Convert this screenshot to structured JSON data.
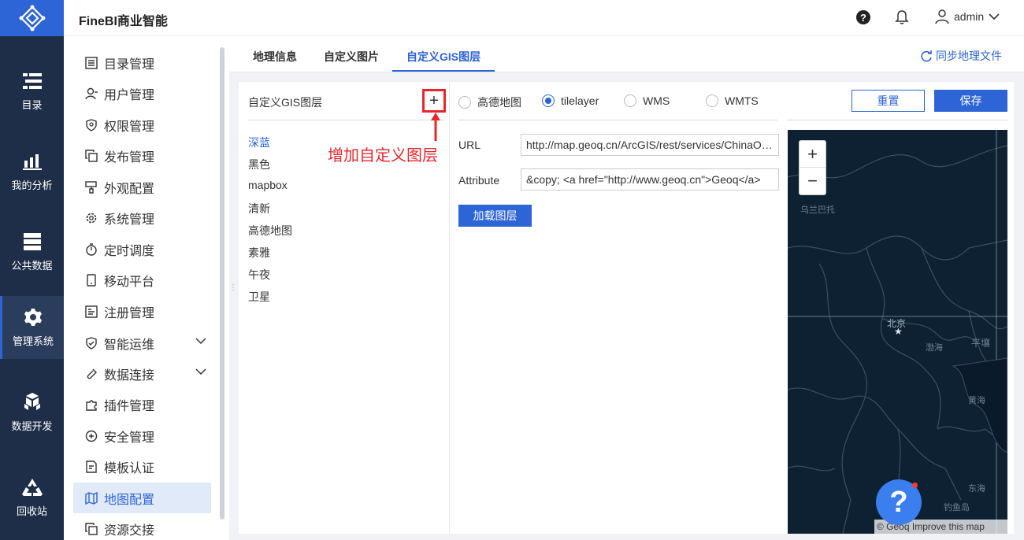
{
  "app": {
    "title": "FineBI商业智能",
    "user": "admin"
  },
  "leftnav": [
    {
      "label": "目录",
      "icon": "catalog-icon"
    },
    {
      "label": "我的分析",
      "icon": "analysis-icon"
    },
    {
      "label": "公共数据",
      "icon": "database-icon"
    },
    {
      "label": "管理系统",
      "icon": "gear-icon",
      "active": true
    },
    {
      "label": "数据开发",
      "icon": "cubes-icon"
    },
    {
      "label": "回收站",
      "icon": "recycle-icon"
    }
  ],
  "submenu": [
    {
      "label": "目录管理",
      "icon": "list-icon"
    },
    {
      "label": "用户管理",
      "icon": "user-icon"
    },
    {
      "label": "权限管理",
      "icon": "shield-icon"
    },
    {
      "label": "发布管理",
      "icon": "copy-icon"
    },
    {
      "label": "外观配置",
      "icon": "brush-icon"
    },
    {
      "label": "系统管理",
      "icon": "gear-icon"
    },
    {
      "label": "定时调度",
      "icon": "timer-icon"
    },
    {
      "label": "移动平台",
      "icon": "phone-icon"
    },
    {
      "label": "注册管理",
      "icon": "register-icon"
    },
    {
      "label": "智能运维",
      "icon": "ops-icon",
      "expandable": true
    },
    {
      "label": "数据连接",
      "icon": "link-icon",
      "expandable": true
    },
    {
      "label": "插件管理",
      "icon": "plugin-icon"
    },
    {
      "label": "安全管理",
      "icon": "security-icon"
    },
    {
      "label": "模板认证",
      "icon": "template-icon"
    },
    {
      "label": "地图配置",
      "icon": "map-icon",
      "active": true
    },
    {
      "label": "资源交接",
      "icon": "resource-icon"
    }
  ],
  "tabs": [
    {
      "label": "地理信息"
    },
    {
      "label": "自定义图片"
    },
    {
      "label": "自定义GIS图层",
      "active": true
    }
  ],
  "sync_label": "同步地理文件",
  "layer_panel": {
    "title": "自定义GIS图层",
    "add_symbol": "+",
    "annotation": "增加自定义图层",
    "layers": [
      "深蓝",
      "黑色",
      "mapbox",
      "清新",
      "高德地图",
      "素雅",
      "午夜",
      "卫星"
    ],
    "selected": "深蓝"
  },
  "config": {
    "types": [
      "高德地图",
      "tilelayer",
      "WMS",
      "WMTS"
    ],
    "selected_type": "tilelayer",
    "url_label": "URL",
    "url_value": "http://map.geoq.cn/ArcGIS/rest/services/ChinaOnlineStreetPurplishBlue/MapServer/tile/{z}/{y}/{x}",
    "attr_label": "Attribute",
    "attr_value": "&copy; <a href=\"http://www.geoq.cn\">Geoq</a>",
    "load_label": "加载图层",
    "reset_label": "重置",
    "save_label": "保存"
  },
  "map": {
    "zoom_in": "+",
    "zoom_out": "−",
    "labels": [
      "乌兰巴托",
      "北京",
      "渤海",
      "平壤",
      "黄海",
      "东海",
      "钓鱼岛"
    ],
    "attribution": "© Geoq Improve this map"
  },
  "help_fab": "?",
  "colors": {
    "brand": "#2d64d6",
    "nav_bg": "#1f2e48",
    "annotation": "#e8262c",
    "map_bg": "#0d2133"
  }
}
